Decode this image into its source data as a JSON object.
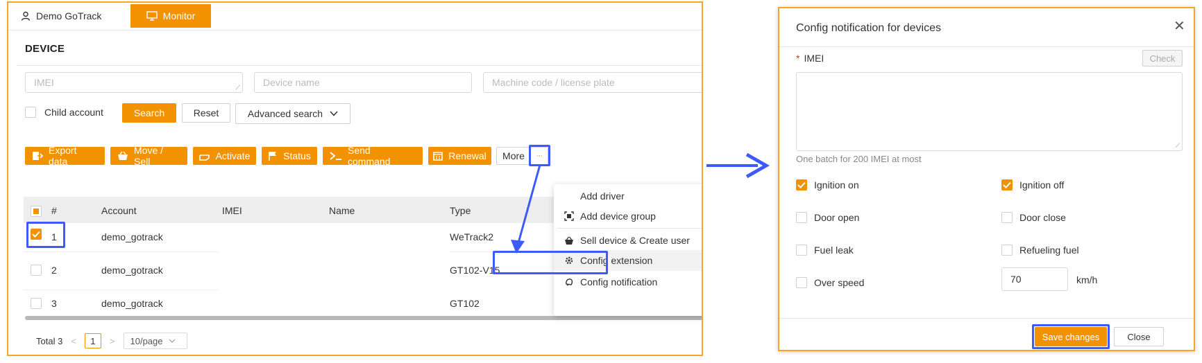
{
  "left": {
    "user_label": "Demo GoTrack",
    "monitor_label": "Monitor",
    "section_title": "DEVICE",
    "filters": {
      "imei_placeholder": "IMEI",
      "device_name_placeholder": "Device name",
      "machine_code_placeholder": "Machine code / license plate",
      "child_account_label": "Child account",
      "search_label": "Search",
      "reset_label": "Reset",
      "advanced_search_label": "Advanced search"
    },
    "actions": {
      "export": "Export data",
      "move_sell": "Move / Sell",
      "activate": "Activate",
      "status": "Status",
      "send_command": "Send command",
      "renewal": "Renewal",
      "more": "More",
      "more_dots": "···"
    },
    "table": {
      "headers": {
        "index": "#",
        "account": "Account",
        "imei": "IMEI",
        "name": "Name",
        "type": "Type"
      },
      "rows": [
        {
          "index": "1",
          "account": "demo_gotrack",
          "imei": "",
          "name": "",
          "type": "WeTrack2",
          "checked": true
        },
        {
          "index": "2",
          "account": "demo_gotrack",
          "imei": "",
          "name": "",
          "type": "GT102-V15",
          "checked": false
        },
        {
          "index": "3",
          "account": "demo_gotrack",
          "imei": "",
          "name": "",
          "type": "GT102",
          "checked": false
        }
      ]
    },
    "more_menu": {
      "items": [
        {
          "label": "Add driver",
          "icon": "none"
        },
        {
          "label": "Add device group",
          "icon": "group-icon"
        },
        {
          "label": "Sell device & Create user",
          "icon": "basket-icon"
        },
        {
          "label": "Config extension",
          "icon": "gear-icon"
        },
        {
          "label": "Config notification",
          "icon": "bell-icon"
        }
      ]
    },
    "pagination": {
      "total": "Total 3",
      "prev": "<",
      "current_page": "1",
      "next": ">",
      "page_size": "10/page"
    }
  },
  "modal": {
    "title": "Config notification for devices",
    "close_x": "✕",
    "imei_required_mark": "*",
    "imei_label": "IMEI",
    "check_label": "Check",
    "imei_value": "",
    "hint": "One batch for 200 IMEI at most",
    "options": [
      {
        "label": "Ignition on",
        "checked": true
      },
      {
        "label": "Ignition off",
        "checked": true
      },
      {
        "label": "Door open",
        "checked": false
      },
      {
        "label": "Door close",
        "checked": false
      },
      {
        "label": "Fuel leak",
        "checked": false
      },
      {
        "label": "Refueling fuel",
        "checked": false
      },
      {
        "label": "Over speed",
        "checked": false
      }
    ],
    "speed_value": "70",
    "speed_unit": "km/h",
    "save_label": "Save changes",
    "close_label": "Close"
  },
  "colors": {
    "accent": "#f39200",
    "highlight": "#3d5afe",
    "panel_border": "#f5a623"
  }
}
